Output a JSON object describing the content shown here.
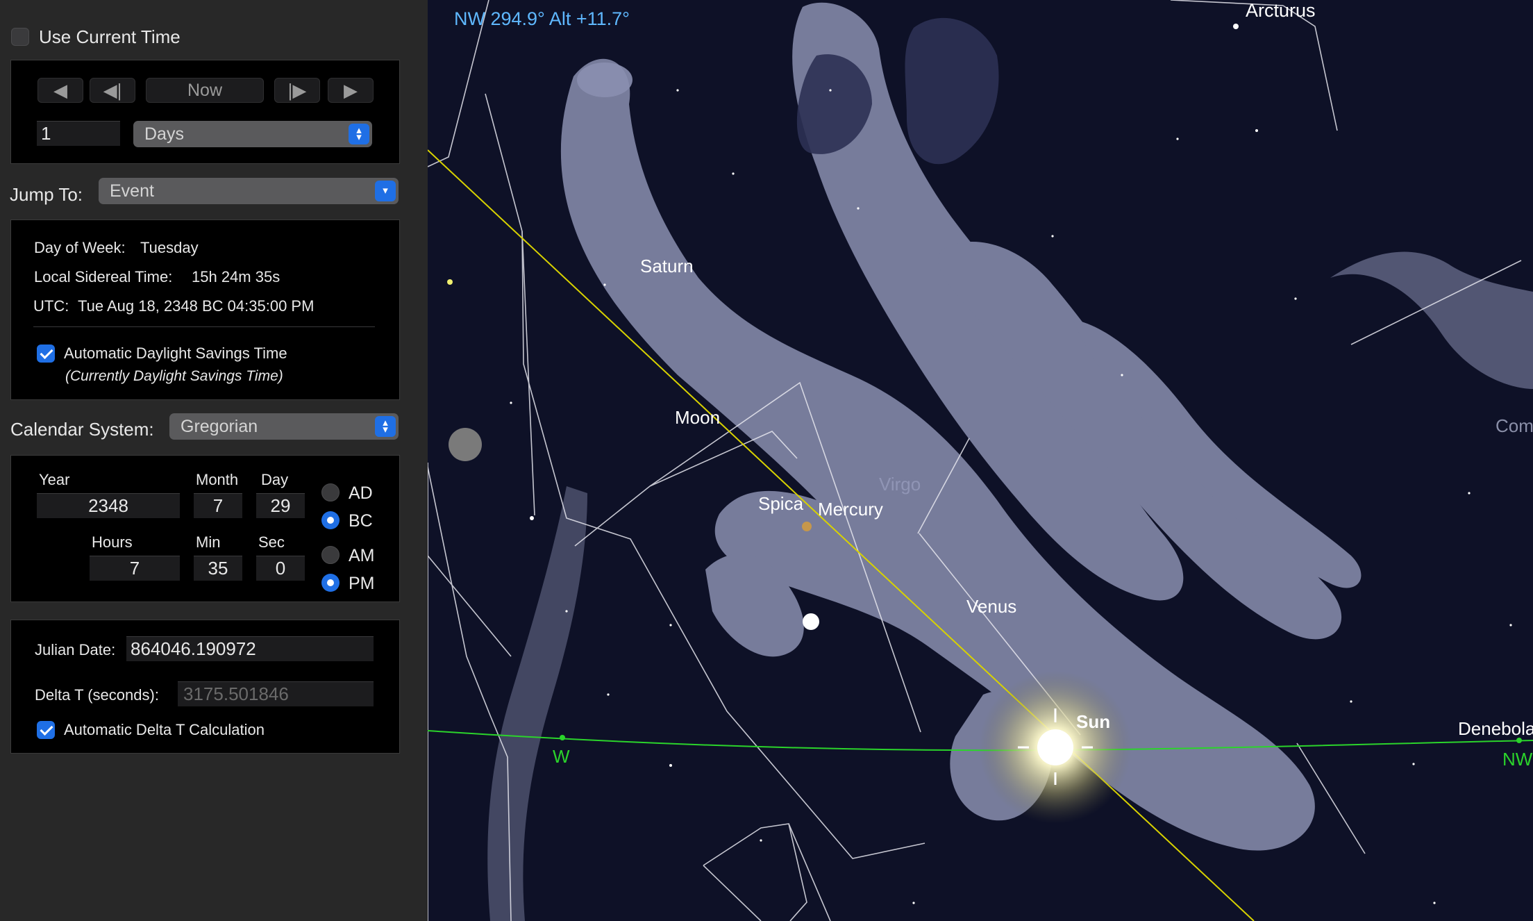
{
  "sidebar": {
    "use_current_time": {
      "label": "Use Current Time",
      "checked": false
    },
    "step_controls": {
      "rewind_icon": "rewind-icon",
      "step_back_icon": "step-back-icon",
      "now_label": "Now",
      "step_forward_icon": "step-forward-icon",
      "play_icon": "play-icon",
      "step_amount": "1",
      "step_unit": "Days"
    },
    "jump_to": {
      "label": "Jump To:",
      "value": "Event"
    },
    "info": {
      "day_of_week_label": "Day of Week:",
      "day_of_week": "Tuesday",
      "sidereal_label": "Local Sidereal Time:",
      "sidereal": "15h 24m 35s",
      "utc_label": "UTC:",
      "utc": "Tue Aug 18, 2348 BC 04:35:00 PM",
      "dst_label": "Automatic Daylight Savings Time",
      "dst_checked": true,
      "dst_note": "(Currently Daylight Savings Time)"
    },
    "calendar": {
      "label": "Calendar System:",
      "value": "Gregorian"
    },
    "date": {
      "year_label": "Year",
      "year": "2348",
      "month_label": "Month",
      "month": "7",
      "day_label": "Day",
      "day": "29",
      "hours_label": "Hours",
      "hours": "7",
      "min_label": "Min",
      "min": "35",
      "sec_label": "Sec",
      "sec": "0",
      "ad_label": "AD",
      "bc_label": "BC",
      "era_selected": "BC",
      "am_label": "AM",
      "pm_label": "PM",
      "ampm_selected": "PM"
    },
    "julian": {
      "julian_label": "Julian Date:",
      "julian_value": "864046.190972",
      "delta_label": "Delta T (seconds):",
      "delta_value": "3175.501846",
      "auto_delta_label": "Automatic Delta T Calculation",
      "auto_delta_checked": true
    }
  },
  "sky": {
    "readout": "NW 294.9° Alt +11.7°",
    "labels": {
      "arcturus": "Arcturus",
      "saturn": "Saturn",
      "moon": "Moon",
      "spica": "Spica",
      "mercury": "Mercury",
      "virgo": "Virgo",
      "venus": "Venus",
      "sun": "Sun",
      "denebola": "Denebola",
      "com": "Com",
      "w": "W",
      "nw": "NW"
    },
    "colors": {
      "sky": "#0e1127",
      "horizon": "#2bd42b",
      "ecliptic": "#d8d200",
      "readout": "#5fb8ff",
      "constellation_art": "#8a8fb0",
      "accent": "#1f6fe5"
    }
  }
}
